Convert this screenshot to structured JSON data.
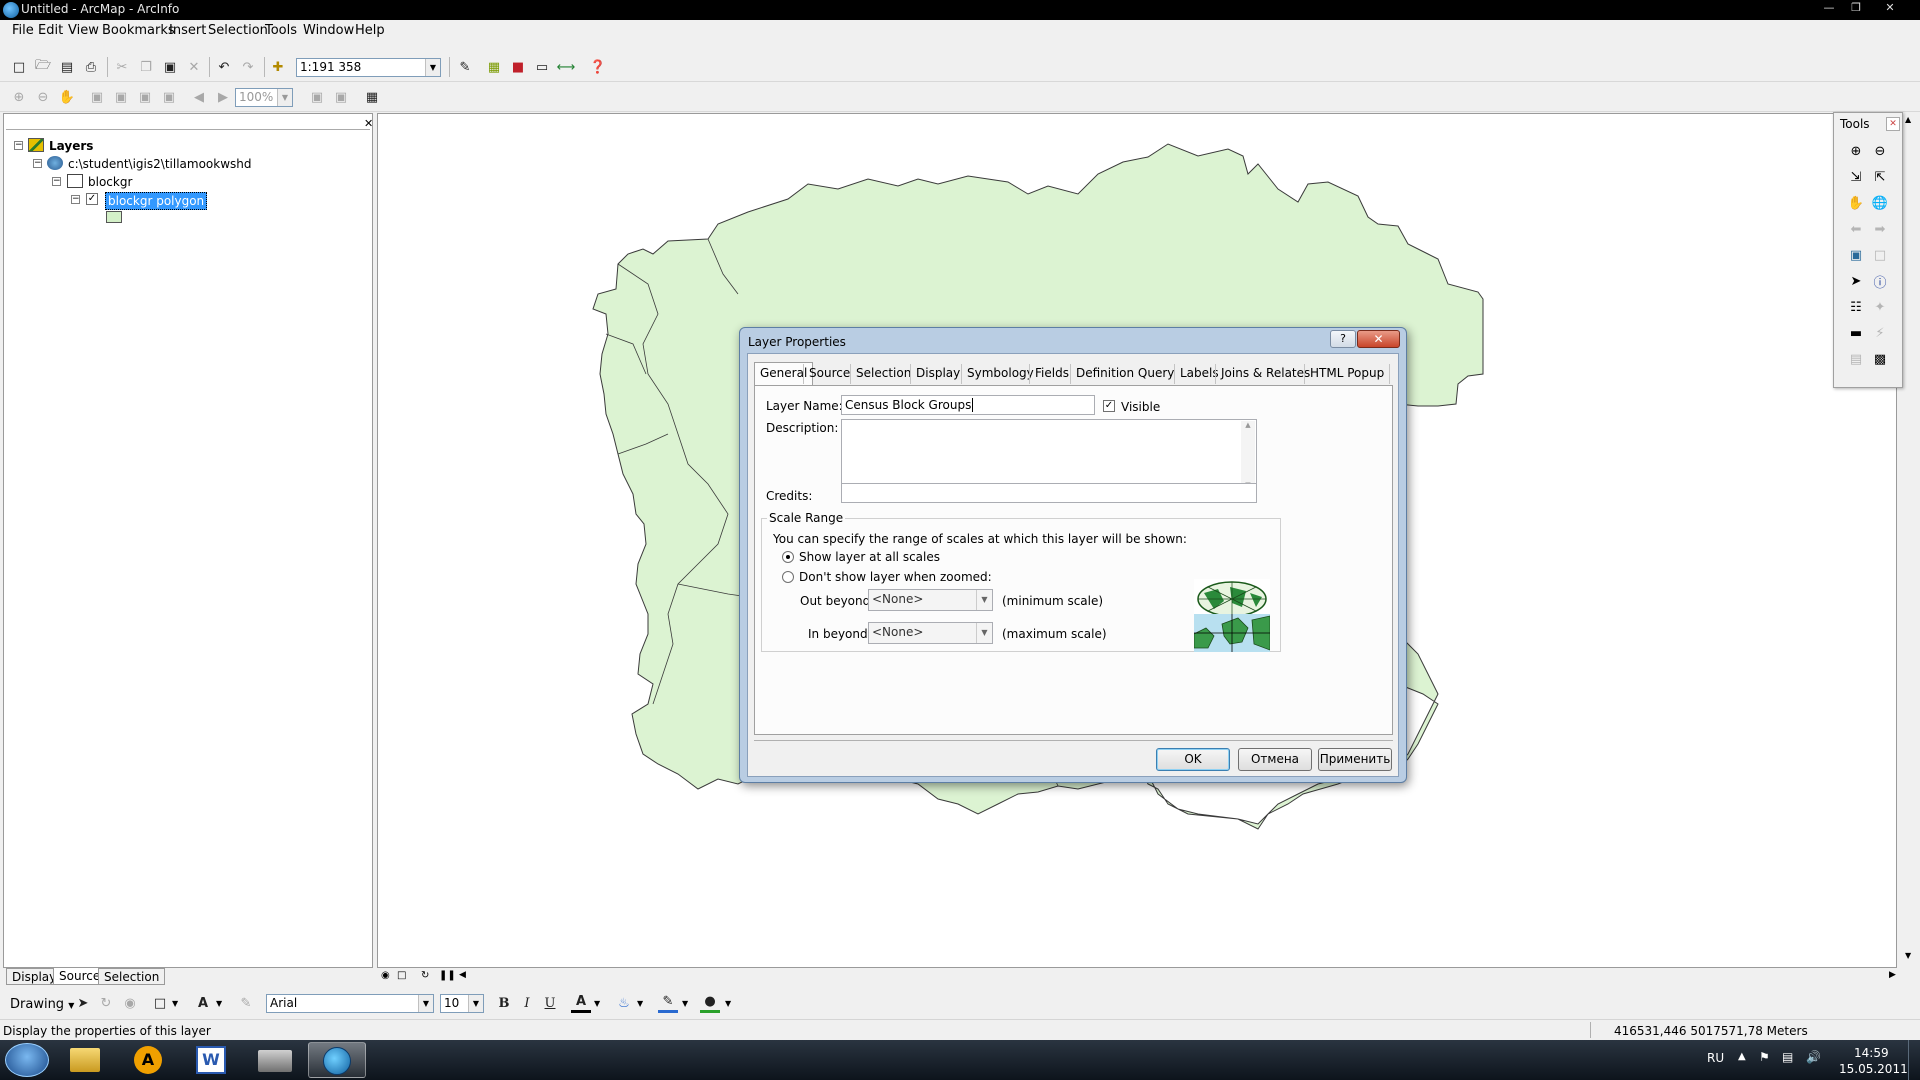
{
  "window": {
    "title": "Untitled - ArcMap - ArcInfo"
  },
  "menu": [
    "File",
    "Edit",
    "View",
    "Bookmarks",
    "Insert",
    "Selection",
    "Tools",
    "Window",
    "Help"
  ],
  "standard_toolbar": {
    "scale": "1:191 358"
  },
  "tools_toolbar": {
    "zoom": "100%"
  },
  "toc": {
    "root": "Layers",
    "data_frame": "c:\\student\\igis2\\tillamookwshd",
    "group": "blockgr",
    "layer": "blockgr polygon",
    "tabs": [
      "Display",
      "Source",
      "Selection"
    ],
    "active_tab": "Source",
    "symbol_color": "#d4f0c8"
  },
  "tools_palette": {
    "title": "Tools"
  },
  "dialog": {
    "title": "Layer Properties",
    "tabs": [
      "General",
      "Source",
      "Selection",
      "Display",
      "Symbology",
      "Fields",
      "Definition Query",
      "Labels",
      "Joins & Relates",
      "HTML Popup"
    ],
    "active_tab": "General",
    "layer_name_label": "Layer Name:",
    "layer_name_value": "Census Block Groups",
    "visible_label": "Visible",
    "description_label": "Description:",
    "description_value": "",
    "credits_label": "Credits:",
    "credits_value": "",
    "scale_range": {
      "title": "Scale Range",
      "intro": "You can specify the range of scales at which this layer will be shown:",
      "option_all": "Show layer at all scales",
      "option_zoomed": "Don't show layer when zoomed:",
      "out_beyond_label": "Out beyond:",
      "out_beyond_value": "<None>",
      "out_beyond_hint": "(minimum scale)",
      "in_beyond_label": "In beyond:",
      "in_beyond_value": "<None>",
      "in_beyond_hint": "(maximum scale)"
    },
    "buttons": {
      "ok": "OK",
      "cancel": "Отмена",
      "apply": "Применить"
    }
  },
  "drawing_toolbar": {
    "label": "Drawing",
    "font": "Arial",
    "font_size": "10",
    "bold": "B",
    "italic": "I",
    "underline": "U"
  },
  "status": {
    "message": "Display the properties of this layer",
    "coordinates": "416531,446  5017571,78 Meters"
  },
  "taskbar": {
    "language": "RU",
    "time": "14:59",
    "date": "15.05.2011"
  },
  "colors": {
    "polygon_fill": "#dcf3d2",
    "polygon_stroke": "#3a3a3a",
    "selection": "#3399ff"
  }
}
